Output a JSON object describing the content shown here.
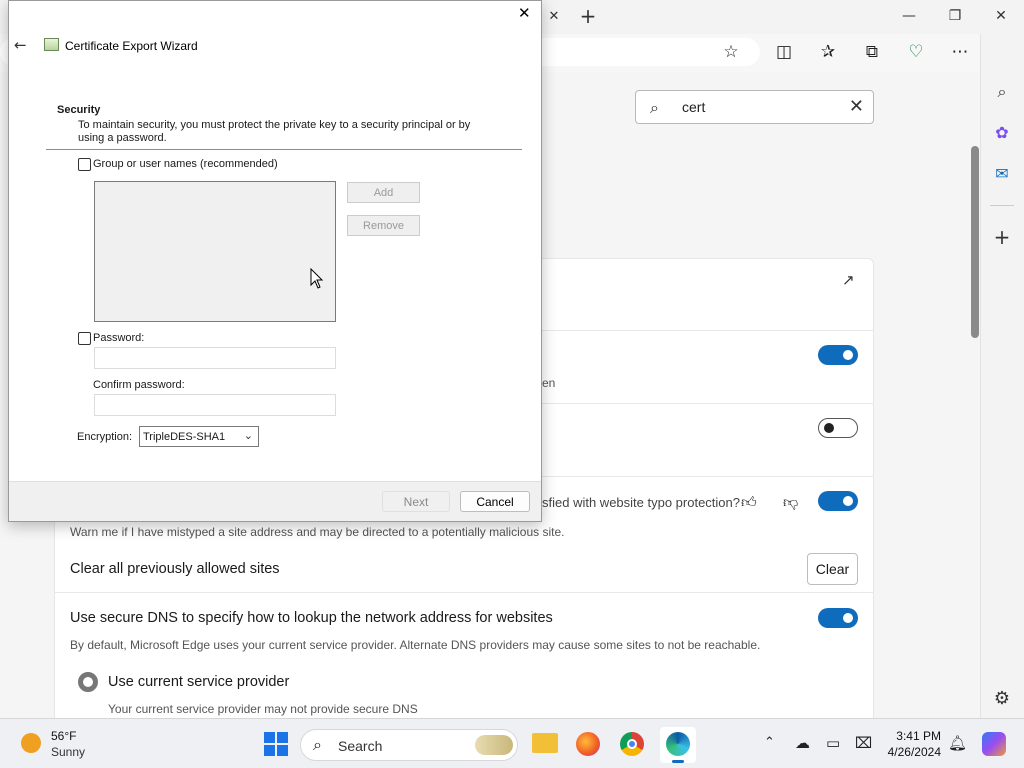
{
  "browser": {
    "new_tab": "+",
    "min": "—",
    "restore": "❐",
    "close": "✕",
    "toolbar_icons": [
      "star-icon",
      "split-screen-icon",
      "favorites-icon",
      "collections-icon",
      "browser-essentials-icon",
      "more-icon",
      "copilot-icon"
    ]
  },
  "settings": {
    "search_value": "cert",
    "typo_question": "sfied with website typo protection?",
    "typo_desc": "Warn me if I have mistyped a site address and may be directed to a potentially malicious site.",
    "partial_text": "en",
    "clear_sites_label": "Clear all previously allowed sites",
    "clear_button": "Clear",
    "dns_title": "Use secure DNS to specify how to lookup the network address for websites",
    "dns_desc": "By default, Microsoft Edge uses your current service provider. Alternate DNS providers may cause some sites to not be reachable.",
    "radio_label": "Use current service provider",
    "radio_desc": "Your current service provider may not provide secure DNS",
    "toggles": [
      true,
      false,
      true,
      true
    ]
  },
  "dialog": {
    "title": "Certificate Export Wizard",
    "section_title": "Security",
    "section_desc": "To maintain security, you must protect the private key to a security principal or by using a password.",
    "group_checkbox": "Group or user names (recommended)",
    "add_button": "Add",
    "remove_button": "Remove",
    "password_checkbox": "Password:",
    "confirm_label": "Confirm password:",
    "encryption_label": "Encryption:",
    "encryption_value": "TripleDES-SHA1",
    "next_button": "Next",
    "cancel_button": "Cancel"
  },
  "taskbar": {
    "temp": "56°F",
    "weather": "Sunny",
    "search_label": "Search",
    "time": "3:41 PM",
    "date": "4/26/2024"
  },
  "colors": {
    "accent": "#0f6cbd",
    "weather_sun": "#f0a020"
  }
}
